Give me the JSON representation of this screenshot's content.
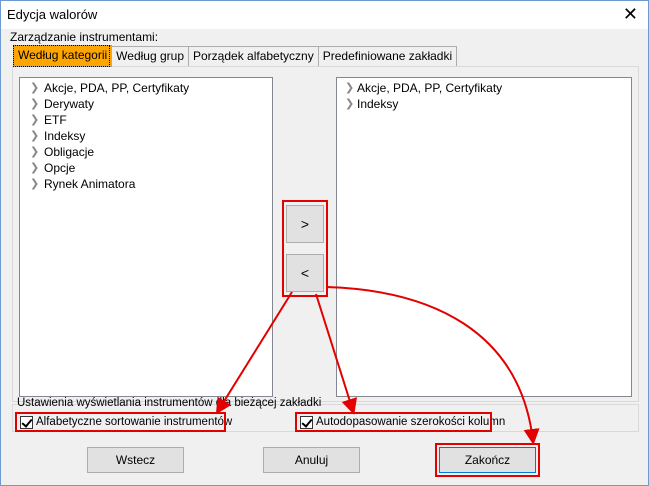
{
  "window": {
    "title": "Edycja walorów",
    "close_glyph": "✕"
  },
  "management_label": "Zarządzanie instrumentami:",
  "tabs": [
    {
      "label": "Według kategorii",
      "active": true
    },
    {
      "label": "Według grup",
      "active": false
    },
    {
      "label": "Porządek alfabetyczny",
      "active": false
    },
    {
      "label": "Predefiniowane zakładki",
      "active": false
    }
  ],
  "left_list": {
    "items": [
      "Akcje, PDA, PP, Certyfikaty",
      "Derywaty",
      "ETF",
      "Indeksy",
      "Obligacje",
      "Opcje",
      "Rynek Animatora"
    ]
  },
  "right_list": {
    "items": [
      "Akcje, PDA, PP, Certyfikaty",
      "Indeksy"
    ]
  },
  "move_buttons": {
    "add_label": ">",
    "remove_label": "<"
  },
  "settings": {
    "label": "Ustawienia wyświetlania instrumentów dla bieżącej zakładki",
    "alphabetical_sort": {
      "label": "Alfabetyczne sortowanie instrumentów",
      "checked": true
    },
    "auto_column_width": {
      "label": "Autodopasowanie szerokości kolumn",
      "checked": true
    }
  },
  "footer": {
    "back_label": "Wstecz",
    "cancel_label": "Anuluj",
    "finish_label": "Zakończ"
  },
  "colors": {
    "active_tab": "#ffa500",
    "annotation_red": "#e20000"
  },
  "icons": {
    "expand": "chevron-right-icon",
    "close": "close-icon",
    "check": "checkmark-icon"
  }
}
